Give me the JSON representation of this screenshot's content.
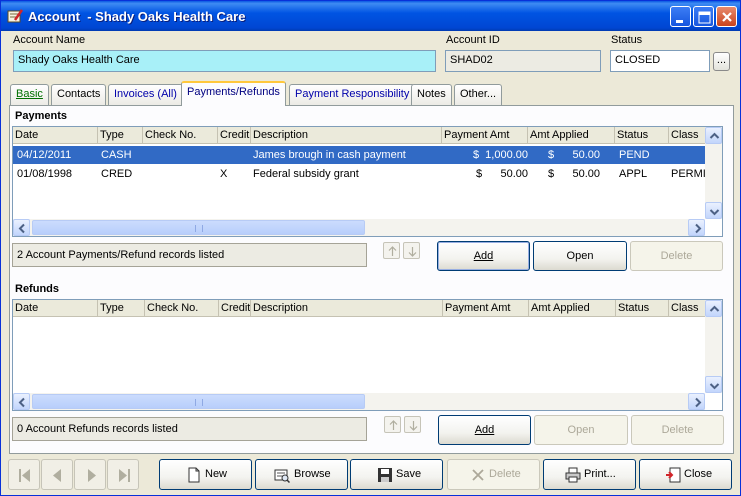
{
  "window": {
    "title": "Account  - Shady Oaks Health Care",
    "icon": "account-app-icon"
  },
  "header": {
    "account_name_label": "Account Name",
    "account_name_value": "Shady Oaks Health Care",
    "account_id_label": "Account ID",
    "account_id_value": "SHAD02",
    "status_label": "Status",
    "status_value": "CLOSED",
    "status_button": "..."
  },
  "tabs": [
    {
      "label": "Basic"
    },
    {
      "label": "Contacts"
    },
    {
      "label": "Invoices (All)"
    },
    {
      "label": "Payments/Refunds"
    },
    {
      "label": "Payment Responsibility"
    },
    {
      "label": "Notes"
    },
    {
      "label": "Other..."
    }
  ],
  "payments": {
    "title": "Payments",
    "columns": [
      "Date",
      "Type",
      "Check No.",
      "Credit",
      "Description",
      "Payment Amt",
      "Amt Applied",
      "Status",
      "Class"
    ],
    "rows": [
      {
        "date": "04/12/2011",
        "type": "CASH",
        "check_no": "",
        "credit": "",
        "description": "James brough in cash payment",
        "payment_amt": "$  1,000.00",
        "amt_applied": "$      50.00",
        "status": "PEND",
        "class": ""
      },
      {
        "date": "01/08/1998",
        "type": "CRED",
        "check_no": "",
        "credit": "X",
        "description": "Federal subsidy grant",
        "payment_amt": "$      50.00",
        "amt_applied": "$      50.00",
        "status": "APPL",
        "class": "PERMI"
      }
    ],
    "selected_row": 0,
    "count_text": "2 Account Payments/Refund records listed",
    "add": "Add",
    "open": "Open",
    "delete": "Delete"
  },
  "refunds": {
    "title": "Refunds",
    "columns": [
      "Date",
      "Type",
      "Check No.",
      "Credit",
      "Description",
      "Payment Amt",
      "Amt Applied",
      "Status",
      "Class"
    ],
    "rows": [],
    "count_text": "0 Account Refunds records listed",
    "add": "Add",
    "open": "Open",
    "delete": "Delete"
  },
  "footer": {
    "new": "New",
    "browse": "Browse",
    "save": "Save",
    "delete": "Delete",
    "print": "Print...",
    "close": "Close"
  },
  "colors": {
    "title_bar": "#0054e3",
    "name_field_bg": "#a8f0f8",
    "selection": "#316ac5",
    "active_tab_accent": "#ffc83c"
  }
}
